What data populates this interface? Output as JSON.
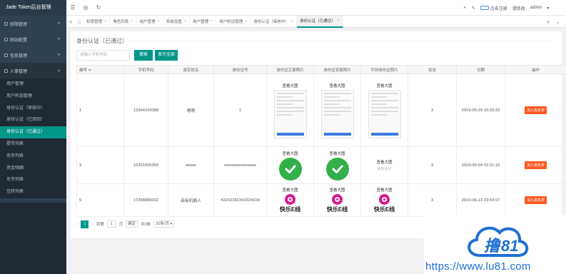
{
  "app": {
    "title": "Jade Token后台管理"
  },
  "topbar": {
    "user_badge": "点击注册",
    "user_tip": "请修改",
    "username": "admin"
  },
  "sidebar": {
    "groups": [
      {
        "label": "权限管理",
        "open": false
      },
      {
        "label": "网站配置",
        "open": false
      },
      {
        "label": "信息管理",
        "open": false
      },
      {
        "label": "人事管理",
        "open": true
      }
    ],
    "items": [
      {
        "label": "用户管理",
        "active": false
      },
      {
        "label": "用户附加管理",
        "active": false
      },
      {
        "label": "身份认证（审核中）",
        "active": false
      },
      {
        "label": "身份认证（已驳回）",
        "active": false
      },
      {
        "label": "身份认证（已通过）",
        "active": true
      },
      {
        "label": "提币列表",
        "active": false
      },
      {
        "label": "充币列表",
        "active": false
      },
      {
        "label": "资金明细",
        "active": false
      },
      {
        "label": "兑币列表",
        "active": false
      },
      {
        "label": "互转列表",
        "active": false
      }
    ]
  },
  "tabs": [
    {
      "label": "权限管理",
      "active": false
    },
    {
      "label": "角色列表",
      "active": false
    },
    {
      "label": "用户管理",
      "active": false
    },
    {
      "label": "系统设置",
      "active": false
    },
    {
      "label": "用户管理",
      "active": false
    },
    {
      "label": "用户附加管理",
      "active": false
    },
    {
      "label": "身份认证（审核中）",
      "active": false
    },
    {
      "label": "身份认证（已通过）",
      "active": true
    }
  ],
  "page": {
    "title": "身份认证（已通过）",
    "search_placeholder": "请输入手机号码",
    "search_button": "搜索",
    "show_all_button": "显示全部"
  },
  "table": {
    "headers": [
      "编号 ≑",
      "手机号码",
      "真实姓名",
      "身份证号",
      "身份证正面照片",
      "身份证背面照片",
      "手持身份证照片",
      "状态",
      "日期",
      "操作"
    ],
    "image_label": "查看大图",
    "action_label": "加入黑名单",
    "rows": [
      {
        "id": "1",
        "phone": "13264242088",
        "name": "嗯嗯",
        "idcard": "1",
        "status": "3",
        "date": "2019-05-29 15:03:22"
      },
      {
        "id": "3",
        "phone": "15321006369",
        "name": "ewwe",
        "idcard": "weewweewewwe",
        "status": "3",
        "date": "2019-06-04 16:31:16"
      },
      {
        "id": "5",
        "phone": "17358880002",
        "name": "高级机器人",
        "idcard": "43242342342324024",
        "status": "3",
        "date": "2019-06-13 23:54:57"
      }
    ],
    "watermark_mini": "鲁客素材",
    "logo_text": "快乐E线"
  },
  "pager": {
    "current": "1",
    "goto_label": "到第",
    "goto_value": "1",
    "page_unit": "页",
    "confirm": "确定",
    "total": "共3条",
    "page_size": "20条/页"
  },
  "watermark": {
    "url": "https://www.lu81.com"
  },
  "colors": {
    "accent": "#009688",
    "danger": "#ff5722",
    "sidebar": "#2f4050"
  }
}
